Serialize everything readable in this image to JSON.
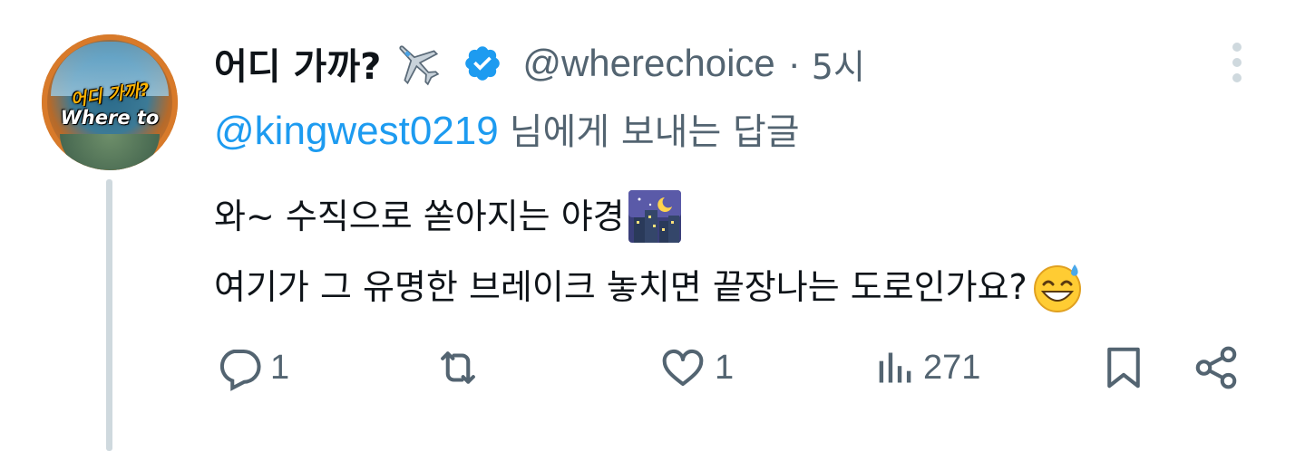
{
  "author": {
    "display_name": "어디 가까?",
    "display_emoji": "airplane-icon",
    "verified": true,
    "handle": "@wherechoice",
    "separator": "·",
    "time": "5시",
    "avatar_text_line1": "어디 가까?",
    "avatar_text_line2": "Where to"
  },
  "reply": {
    "mention": "@kingwest0219",
    "suffix": "님에게 보내는 답글"
  },
  "body": {
    "line1": "와~ 수직으로 쏟아지는 야경",
    "line1_emoji": "night-city-icon",
    "line2": "여기가 그 유명한 브레이크 놓치면 끝장나는 도로인가요?",
    "line2_emoji": "grinning-sweat-icon"
  },
  "actions": {
    "reply_count": "1",
    "retweet_count": "",
    "like_count": "1",
    "views_count": "271"
  },
  "colors": {
    "text": "#0f1419",
    "secondary": "#536471",
    "link": "#1d9bf0",
    "verified": "#1d9bf0",
    "thread_line": "#cfd9de"
  }
}
